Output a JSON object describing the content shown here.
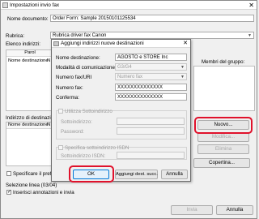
{
  "window": {
    "title": "Impostazioni invio fax",
    "close": "✕"
  },
  "main": {
    "doc_name_label": "Nome documento:",
    "doc_name_value": "Order Form: Sample 20150101125534",
    "rubrica_label": "Rubrica:",
    "rubrica_value": "Rubrica driver fax Canon",
    "elenco_label": "Elenco indirizzi:",
    "list_header_parole": "Parol",
    "list_col_nome": "Nome destinazione",
    "list_col_n": "N",
    "membri_label": "Membri del gruppo:",
    "indirizzi_dest_label": "Indirizzo di destinazione",
    "dest_col_nome": "Nome destinazione",
    "dest_col_n": "N",
    "btn_nuovo": "Nuovo...",
    "btn_modifica": "Modifica...",
    "btn_elimina": "Elimina",
    "btn_copertina": "Copertina...",
    "specifica_prefisso": "Specificare il prefisso",
    "selezione_linea": "Selezione linea (03/04)",
    "inserisci_annotazioni": "Inserisci annotazioni e invia",
    "btn_invia": "Invia",
    "btn_annulla": "Annulla"
  },
  "dialog": {
    "title": "Aggiungi indirizzi nuove destinazioni",
    "close": "✕",
    "nome_label": "Nome destinazione:",
    "nome_value": "AGOSTO e STORE Inc",
    "modalita_label": "Modalità di comunicazione:",
    "modalita_value": "G3/G4",
    "numero_fax_uri_label": "Numero fax/URI",
    "numero_fax_uri_value": "Numero fax",
    "numero_fax_label": "Numero fax:",
    "numero_fax_value": "XXXXXXXXXXXXXX",
    "conferma_label": "Conferma:",
    "conferma_value": "XXXXXXXXXXXXXX",
    "utilizza_sottoindirizzo": "Utilizza Sottoindirizzo",
    "sottoindirizzo_label": "Sottoindirizzo:",
    "password_label": "Password:",
    "specifica_isdn": "Specifica sottoindirizzo ISDN",
    "sottoindirizzo_isdn_label": "Sottoindirizzo ISDN:",
    "btn_ok": "OK",
    "btn_aggiungi": "Aggiungi dest. succ.",
    "btn_annulla": "Annulla"
  },
  "colors": {
    "highlight": "#e0112b"
  }
}
